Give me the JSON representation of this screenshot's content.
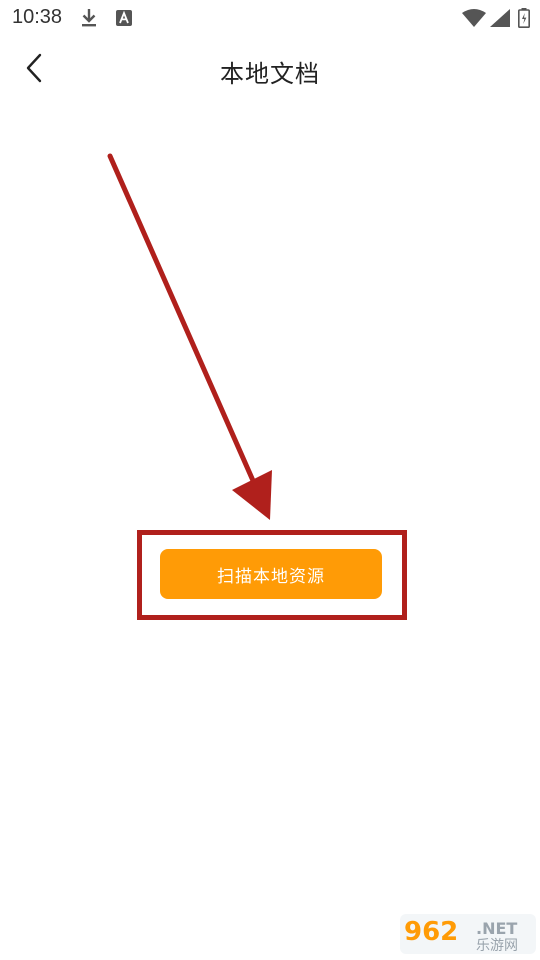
{
  "status_bar": {
    "time": "10:38",
    "icons": [
      "download-icon",
      "a-notification-icon",
      "wifi-icon",
      "signal-icon",
      "battery-icon"
    ]
  },
  "header": {
    "back_icon": "chevron-left-icon",
    "title": "本地文档"
  },
  "main": {
    "scan_button_label": "扫描本地资源"
  },
  "annotation": {
    "arrow_color": "#b0201c",
    "box_color": "#b0201c"
  },
  "watermark": {
    "number": "962",
    "suffix": ".NET",
    "subtitle": "乐游网"
  },
  "colors": {
    "accent": "#ff9b06",
    "annotation": "#b0201c"
  }
}
